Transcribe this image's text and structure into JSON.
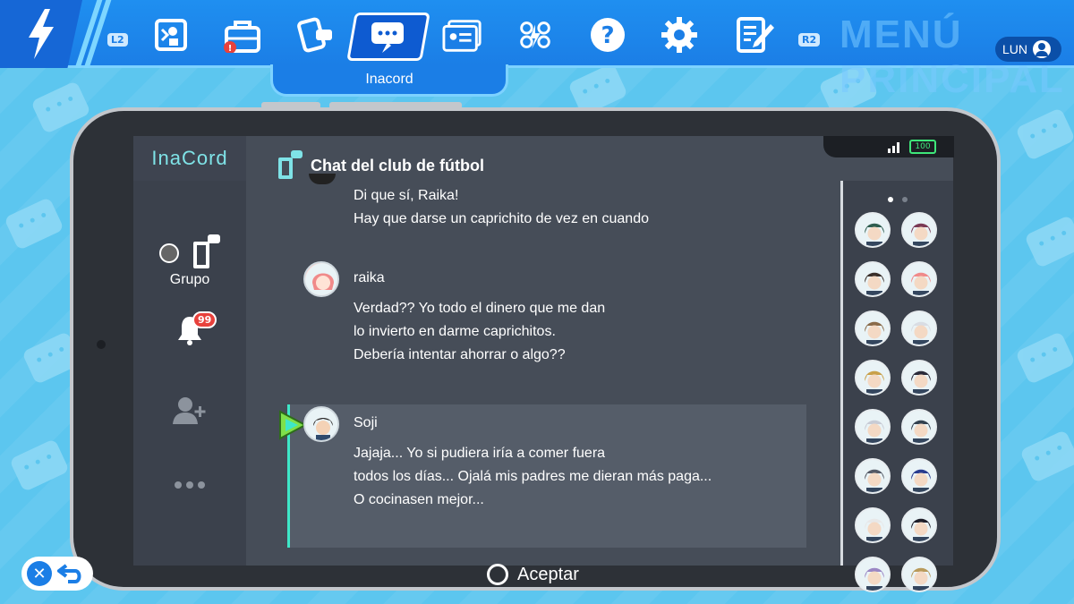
{
  "topbar": {
    "l2": "L2",
    "r2": "R2",
    "active_tab_label": "Inacord",
    "bg_title": "MENÚ PRINCIPAL",
    "day": "LUN"
  },
  "sidebar": {
    "logo": "InaCord",
    "group_label": "Grupo",
    "notif_count": "99"
  },
  "chat": {
    "title": "Chat del club de fútbol",
    "messages": [
      {
        "author": "",
        "lines": [
          "Di que sí, Raika!",
          "Hay que darse un caprichito de vez en cuando"
        ]
      },
      {
        "author": "raika",
        "lines": [
          "Verdad?? Yo todo el dinero que me dan",
          "lo invierto en darme caprichitos.",
          "Debería intentar ahorrar o algo??"
        ]
      },
      {
        "author": "Soji",
        "lines": [
          "Jajaja... Yo si pudiera iría a comer fuera",
          "todos los días... Ojalá mis padres me dieran más paga...",
          "O cocinasen mejor..."
        ]
      }
    ]
  },
  "status": {
    "battery": "100"
  },
  "footer": {
    "accept_label": "Aceptar"
  },
  "colors": {
    "accent": "#1b7ee6",
    "chat_bg": "#464d58",
    "teal": "#3ee7c8",
    "badge": "#e8413c"
  }
}
